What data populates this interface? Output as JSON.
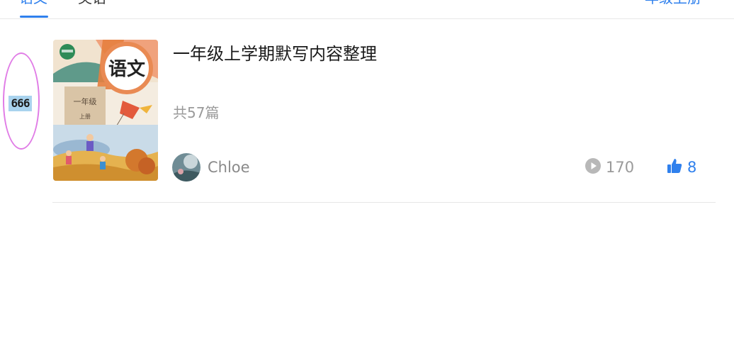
{
  "tabs": {
    "active_label": "语文",
    "inactive_label": "英语",
    "grade_selector_label": "一年级上册"
  },
  "annotation": {
    "label": "666"
  },
  "card": {
    "cover": {
      "subject": "语文",
      "grade": "一年级",
      "volume": "上册"
    },
    "title": "一年级上学期默写内容整理",
    "count": "共57篇",
    "author": "Chloe",
    "plays": "170",
    "likes": "8"
  },
  "icons": {
    "play": "play-circle-icon",
    "like": "thumbs-up-icon"
  },
  "colors": {
    "accent": "#2f80ed",
    "annotation_ring": "#e07ce6",
    "annotation_bg": "#a9d3ee"
  }
}
